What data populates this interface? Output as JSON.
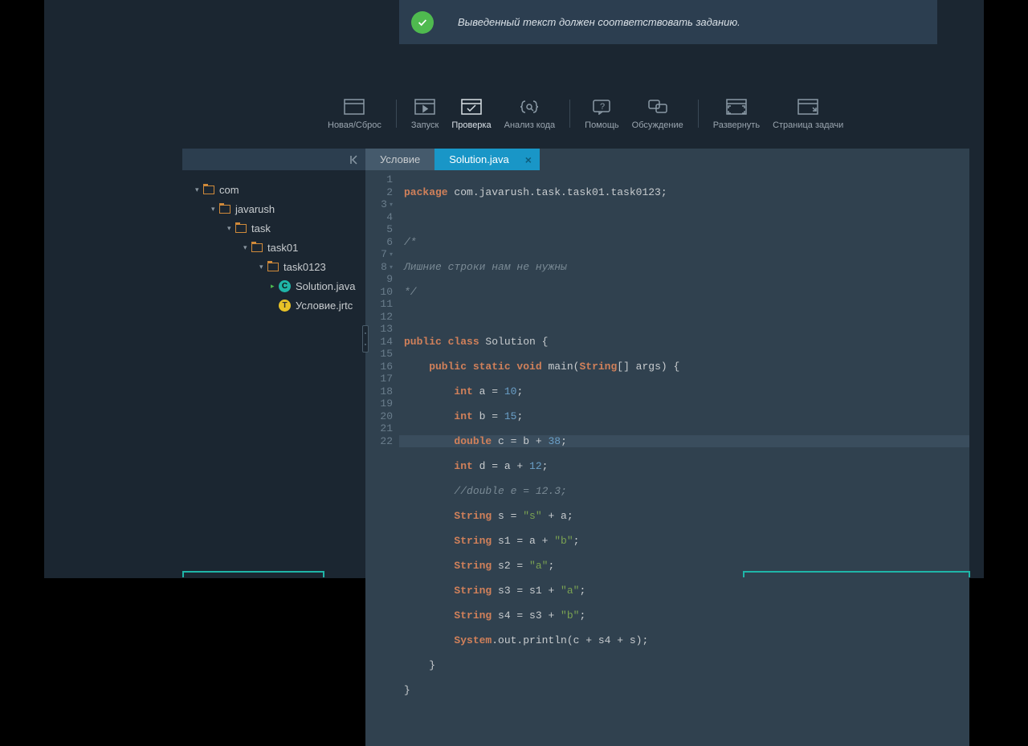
{
  "notice": {
    "text": "Выведенный текст должен соответствовать заданию."
  },
  "toolbar": {
    "new": "Новая/Сброс",
    "run": "Запуск",
    "check": "Проверка",
    "analyze": "Анализ кода",
    "help": "Помощь",
    "discuss": "Обсуждение",
    "expand": "Развернуть",
    "taskpage": "Страница задачи"
  },
  "tabs": {
    "condition": "Условие",
    "solution": "Solution.java"
  },
  "tree": {
    "com": "com",
    "javarush": "javarush",
    "task": "task",
    "task01": "task01",
    "task0123": "task0123",
    "solution": "Solution.java",
    "condition": "Условие.jrtc"
  },
  "gutter": [
    "1",
    "2",
    "3",
    "4",
    "5",
    "6",
    "7",
    "8",
    "9",
    "10",
    "11",
    "12",
    "13",
    "14",
    "15",
    "16",
    "17",
    "18",
    "19",
    "20",
    "21",
    "22"
  ],
  "code": {
    "l1a": "package",
    "l1b": " com.javarush.task.task01.task0123;",
    "l3": "/*",
    "l4": "Лишние строки нам не нужны",
    "l5": "*/",
    "l7a": "public class ",
    "l7b": "Solution ",
    "l7c": "{",
    "l8a": "    public static void ",
    "l8b": "main",
    "l8c": "(",
    "l8d": "String",
    "l8e": "[] args) {",
    "l9a": "        int ",
    "l9b": "a = ",
    "l9c": "10",
    "l9d": ";",
    "l10a": "        int ",
    "l10b": "b = ",
    "l10c": "15",
    "l10d": ";",
    "l11a": "        double ",
    "l11b": "c = b + ",
    "l11c": "38",
    "l11d": ";",
    "l12a": "        int ",
    "l12b": "d = a + ",
    "l12c": "12",
    "l12d": ";",
    "l13": "        //double e = 12.3;",
    "l14a": "        String ",
    "l14b": "s = ",
    "l14c": "\"s\"",
    "l14d": " + a;",
    "l15a": "        String ",
    "l15b": "s1 = a + ",
    "l15c": "\"b\"",
    "l15d": ";",
    "l16a": "        String ",
    "l16b": "s2 = ",
    "l16c": "\"a\"",
    "l16d": ";",
    "l17a": "        String ",
    "l17b": "s3 = s1 + ",
    "l17c": "\"a\"",
    "l17d": ";",
    "l18a": "        String ",
    "l18b": "s4 = s3 + ",
    "l18c": "\"b\"",
    "l18d": ";",
    "l19a": "        System",
    "l19b": ".out.println(c + s4 + s);",
    "l20": "    }",
    "l21": "}"
  }
}
